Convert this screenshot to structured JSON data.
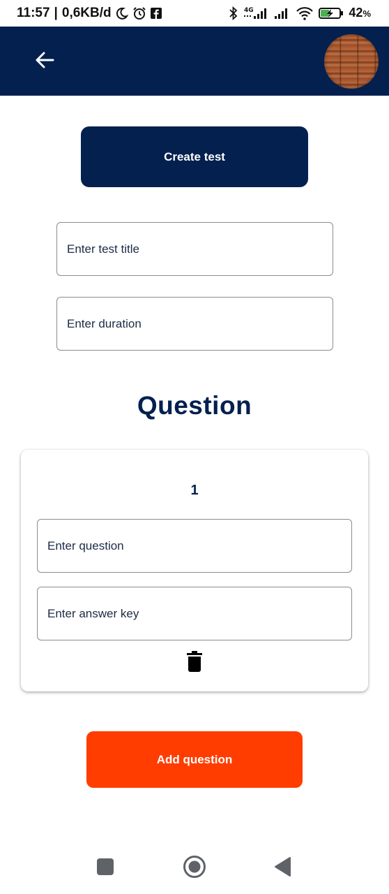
{
  "status_bar": {
    "time": "11:57",
    "separator": "|",
    "data_rate": "0,6KB/d",
    "network_label": "4G",
    "battery_percent": "42",
    "battery_unit": "%"
  },
  "header": {
    "back_icon": "arrow-left-icon",
    "avatar": "profile-avatar"
  },
  "form": {
    "create_button_label": "Create test",
    "title_placeholder": "Enter test title",
    "duration_placeholder": "Enter duration",
    "section_heading": "Question"
  },
  "questions": [
    {
      "number": "1",
      "question_placeholder": "Enter question",
      "answer_placeholder": "Enter answer key",
      "delete_icon": "trash-icon"
    }
  ],
  "actions": {
    "add_question_label": "Add question"
  },
  "navigation": {
    "recent_icon": "square-icon",
    "home_icon": "circle-icon",
    "back_icon": "triangle-back-icon"
  },
  "colors": {
    "primary": "#03204f",
    "accent": "#ff3d00",
    "background": "#ffffff"
  }
}
